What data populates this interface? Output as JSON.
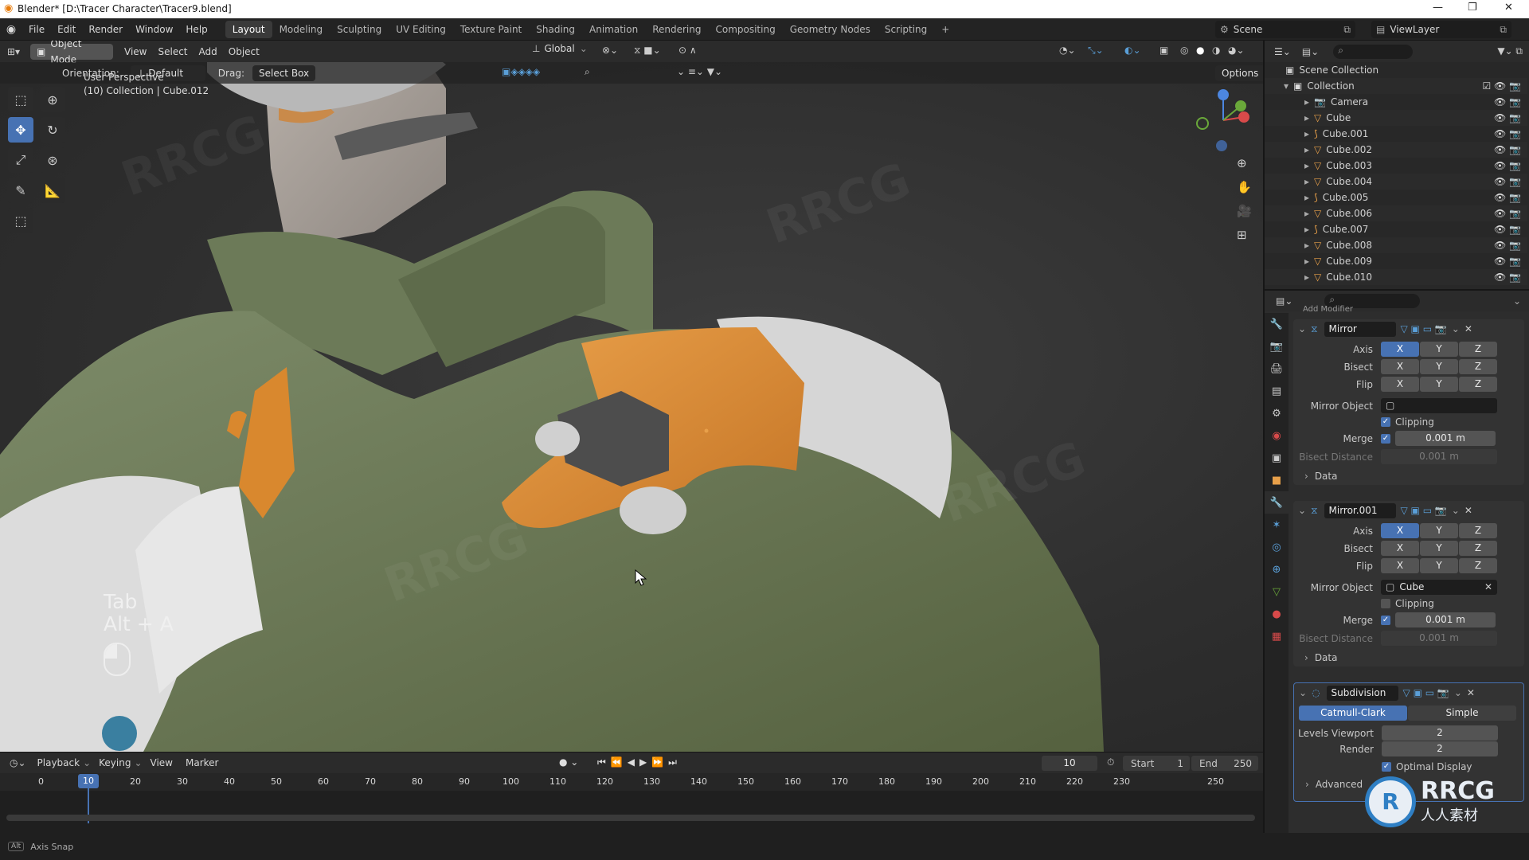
{
  "title_bar": {
    "title": "Blender* [D:\\Tracer Character\\Tracer9.blend]",
    "min": "—",
    "max": "❐",
    "close": "✕"
  },
  "menu": [
    "File",
    "Edit",
    "Render",
    "Window",
    "Help"
  ],
  "workspaces": [
    "Layout",
    "Modeling",
    "Sculpting",
    "UV Editing",
    "Texture Paint",
    "Shading",
    "Animation",
    "Rendering",
    "Compositing",
    "Geometry Nodes",
    "Scripting",
    "+"
  ],
  "scene": {
    "label": "Scene",
    "view_layer": "ViewLayer"
  },
  "viewport_header": {
    "mode": "Object Mode",
    "menus": [
      "View",
      "Select",
      "Add",
      "Object"
    ],
    "transform": "Global",
    "orientation_label": "Orientation:",
    "orientation_value": "Default",
    "drag_label": "Drag:",
    "drag_value": "Select Box",
    "options": "Options"
  },
  "viewport_overlay": {
    "perspective": "User Perspective",
    "collection": "(10) Collection | Cube.012",
    "key1": "Tab",
    "key2": "Alt + A"
  },
  "outliner": {
    "scene_collection": "Scene Collection",
    "collection": "Collection",
    "items": [
      "Camera",
      "Cube",
      "Cube.001",
      "Cube.002",
      "Cube.003",
      "Cube.004",
      "Cube.005",
      "Cube.006",
      "Cube.007",
      "Cube.008",
      "Cube.009",
      "Cube.010"
    ]
  },
  "properties": {
    "add_modifier": "Add Modifier",
    "mirror1": {
      "name": "Mirror",
      "axis": "Axis",
      "bisect": "Bisect",
      "flip": "Flip",
      "x": "X",
      "y": "Y",
      "z": "Z",
      "mirror_object_label": "Mirror Object",
      "mirror_object": "",
      "clipping": "Clipping",
      "merge": "Merge",
      "merge_value": "0.001 m",
      "bisect_distance": "Bisect Distance",
      "bisect_distance_value": "0.001 m",
      "data": "Data"
    },
    "mirror2": {
      "name": "Mirror.001",
      "axis": "Axis",
      "bisect": "Bisect",
      "flip": "Flip",
      "x": "X",
      "y": "Y",
      "z": "Z",
      "mirror_object_label": "Mirror Object",
      "mirror_object": "Cube",
      "clipping": "Clipping",
      "merge": "Merge",
      "merge_value": "0.001 m",
      "bisect_distance": "Bisect Distance",
      "bisect_distance_value": "0.001 m",
      "data": "Data"
    },
    "subdivision": {
      "name": "Subdivision",
      "catmull": "Catmull-Clark",
      "simple": "Simple",
      "levels_viewport_label": "Levels Viewport",
      "levels_viewport": "2",
      "render_label": "Render",
      "render": "2",
      "optimal": "Optimal Display",
      "advanced": "Advanced"
    }
  },
  "timeline": {
    "menus": [
      "Playback",
      "Keying",
      "View",
      "Marker"
    ],
    "current_frame": "10",
    "start_label": "Start",
    "start": "1",
    "end_label": "End",
    "end": "250",
    "ticks": [
      "0",
      "10",
      "20",
      "30",
      "40",
      "50",
      "60",
      "70",
      "80",
      "90",
      "100",
      "110",
      "120",
      "130",
      "140",
      "150",
      "160",
      "170",
      "180",
      "190",
      "200",
      "210",
      "220",
      "230",
      "250"
    ]
  },
  "status": {
    "axis_snap": "Axis Snap"
  },
  "watermark": {
    "brand": "RRCG",
    "sub": "人人素材"
  },
  "colors": {
    "accent": "#4772b3",
    "jacket": "#6b7a5a",
    "orange": "#d9882e",
    "origin": "#e8a04a"
  }
}
